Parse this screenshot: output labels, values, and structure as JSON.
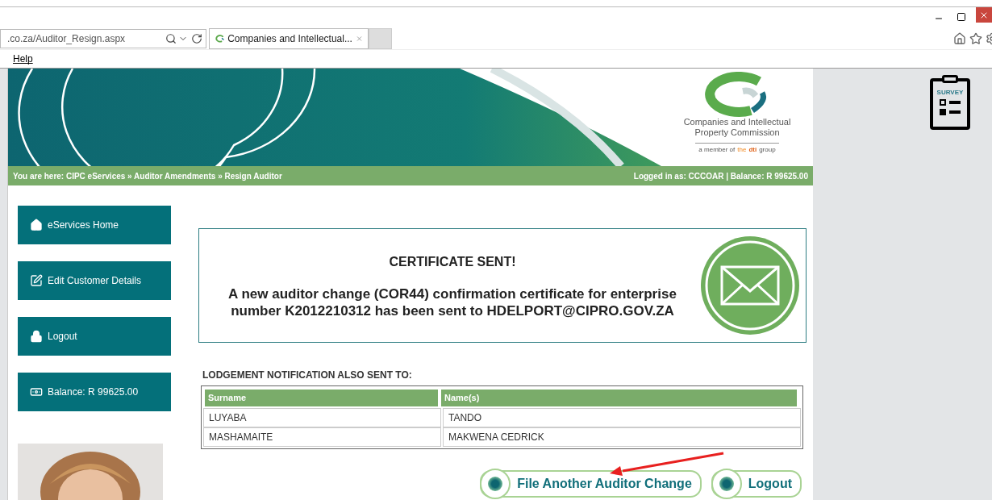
{
  "browser": {
    "address": ".co.za/Auditor_Resign.aspx",
    "tab": {
      "title": "Companies and Intellectual...",
      "selected": true
    },
    "menu": [
      "Help"
    ]
  },
  "banner": {
    "logo_lines": [
      "Companies and Intellectual",
      "Property Commission"
    ],
    "tagline": [
      {
        "text": "a member of",
        "kind": "plain"
      },
      {
        "text": "the",
        "kind": "accent"
      },
      {
        "text": "dti",
        "kind": "strong"
      },
      {
        "text": "group",
        "kind": "plain"
      }
    ]
  },
  "breadcrumb": "You are here: CIPC eServices » Auditor Amendments » Resign Auditor",
  "login_status": "Logged in as: CCCOAR | Balance: R 99625.00",
  "sidebar": {
    "items": [
      {
        "label": "eServices Home",
        "kind": "home"
      },
      {
        "label": "Edit Customer Details",
        "kind": "edit"
      },
      {
        "label": "Logout",
        "kind": "lock"
      },
      {
        "label": "Balance: R 99625.00",
        "kind": "money"
      }
    ]
  },
  "certificate": {
    "title": "CERTIFICATE SENT!",
    "message": "A new auditor change (COR44) confirmation certificate for enterprise number K2012210312 has been sent to HDELPORT@CIPRO.GOV.ZA"
  },
  "notification": {
    "label": "LODGEMENT NOTIFICATION ALSO SENT TO:",
    "columns": [
      "Surname",
      "Name(s)"
    ],
    "rows": [
      [
        "LUYABA",
        "TANDO"
      ],
      [
        "MASHAMAITE",
        "MAKWENA CEDRICK"
      ]
    ]
  },
  "actions": [
    "File Another Auditor Change",
    "Logout"
  ],
  "survey": {
    "label": "SURVEY"
  }
}
